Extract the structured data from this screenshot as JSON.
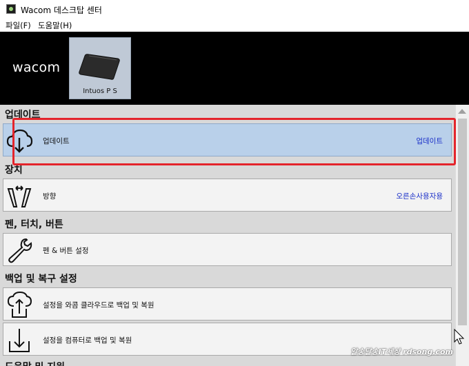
{
  "window": {
    "title": "Wacom 데스크탑 센터"
  },
  "menu": {
    "items": [
      "파일(F)",
      "도움말(H)"
    ]
  },
  "brand": {
    "logo_text": "wacom"
  },
  "device": {
    "name": "Intuos P S"
  },
  "sections": [
    {
      "title": "업데이트",
      "rows": [
        {
          "label": "업데이트",
          "value": "업데이트",
          "icon": "cloud-download-icon",
          "selected": true
        }
      ]
    },
    {
      "title": "장치",
      "rows": [
        {
          "label": "방향",
          "value": "오른손사용자용",
          "icon": "pen-orientation-icon"
        }
      ]
    },
    {
      "title": "펜, 터치, 버튼",
      "rows": [
        {
          "label": "펜 & 버튼 설정",
          "icon": "wrench-icon"
        }
      ]
    },
    {
      "title": "백업 및 복구 설정",
      "rows": [
        {
          "label": "설정을 와콤 클라우드로 백업 및 복원",
          "icon": "cloud-upload-icon"
        },
        {
          "label": "설정을 컴퓨터로 백업 및 복원",
          "icon": "download-tray-icon"
        }
      ]
    },
    {
      "title": "도움말 및 지원"
    }
  ],
  "watermark": "알송달송IT세상 rdsong.com",
  "colors": {
    "highlight": "#e4242b",
    "selected_row": "#b9d0ea",
    "value_text": "#1a2fc8"
  }
}
